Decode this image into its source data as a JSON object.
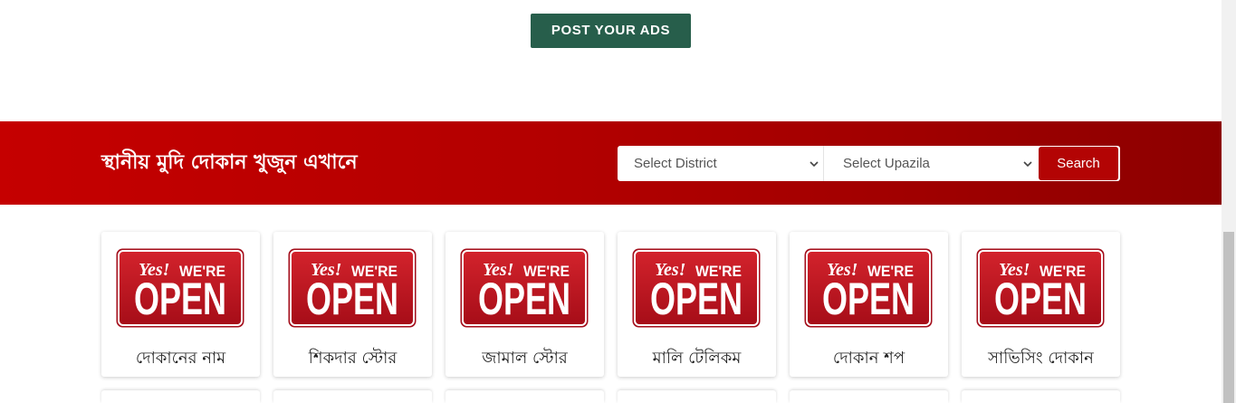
{
  "header": {
    "post_ads_label": "POST YOUR ADS"
  },
  "banner": {
    "title": "স্থানীয় মুদি দোকান খুজুন এখানে",
    "district_select": {
      "selected": "Select District",
      "icon": "chevron-down-icon"
    },
    "upazila_select": {
      "selected": "Select Upazila",
      "icon": "chevron-down-icon"
    },
    "search_label": "Search"
  },
  "shop_sign": {
    "script_text": "Yes!",
    "caps_text": "WE'RE",
    "big_text": "OPEN",
    "icon": "open-sign-image"
  },
  "shops": [
    {
      "name": "দোকানের নাম"
    },
    {
      "name": "শিকদার স্টোর"
    },
    {
      "name": "জামাল স্টোর"
    },
    {
      "name": "মালি টেলিকম"
    },
    {
      "name": "দোকান শপ"
    },
    {
      "name": "সাভিসিং দোকান"
    }
  ],
  "colors": {
    "post_button": "#275e4b",
    "banner_red": "#c50000",
    "banner_red_dark": "#8c0000",
    "search_button": "#b30404",
    "sign_red": "#c8101e"
  }
}
